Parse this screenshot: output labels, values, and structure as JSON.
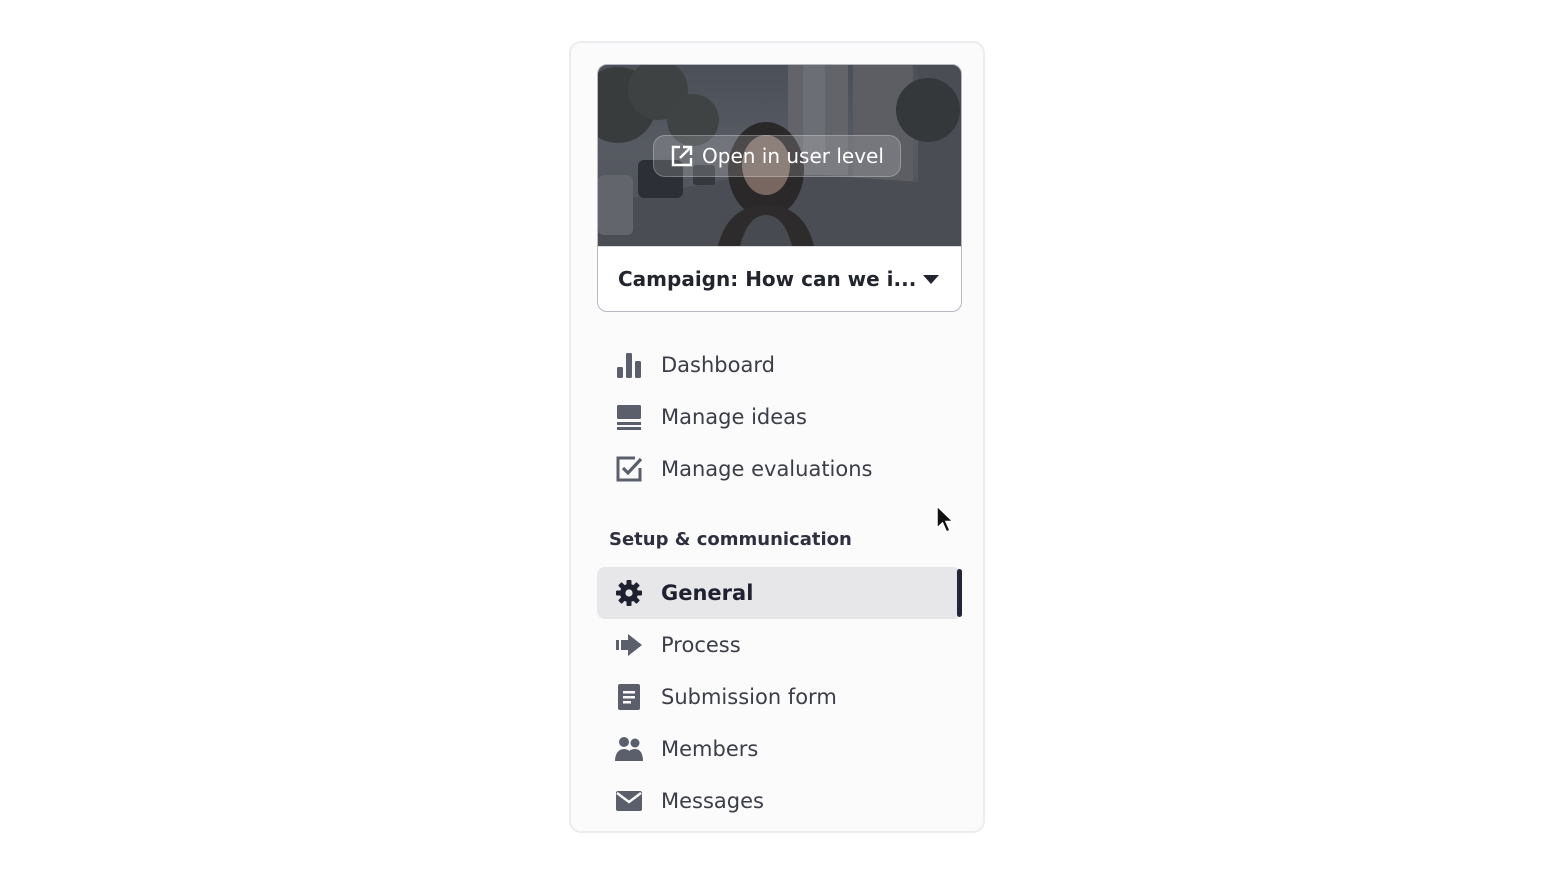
{
  "campaign": {
    "open_button_label": "Open in user level",
    "selected_campaign": "Campaign: How can we i..."
  },
  "nav": {
    "main_items": [
      {
        "label": "Dashboard",
        "icon": "bar-chart-icon"
      },
      {
        "label": "Manage ideas",
        "icon": "list-icon"
      },
      {
        "label": "Manage evaluations",
        "icon": "checkbox-icon"
      }
    ],
    "section_title": "Setup & communication",
    "setup_items": [
      {
        "label": "General",
        "icon": "gear-icon",
        "active": true
      },
      {
        "label": "Process",
        "icon": "arrow-right-icon"
      },
      {
        "label": "Submission form",
        "icon": "form-icon"
      },
      {
        "label": "Members",
        "icon": "people-icon"
      },
      {
        "label": "Messages",
        "icon": "envelope-icon"
      }
    ]
  },
  "colors": {
    "icon": "#5b5e6b",
    "active_bg": "#e7e7e9",
    "active_indicator": "#23253a",
    "text": "#3b3d47"
  }
}
